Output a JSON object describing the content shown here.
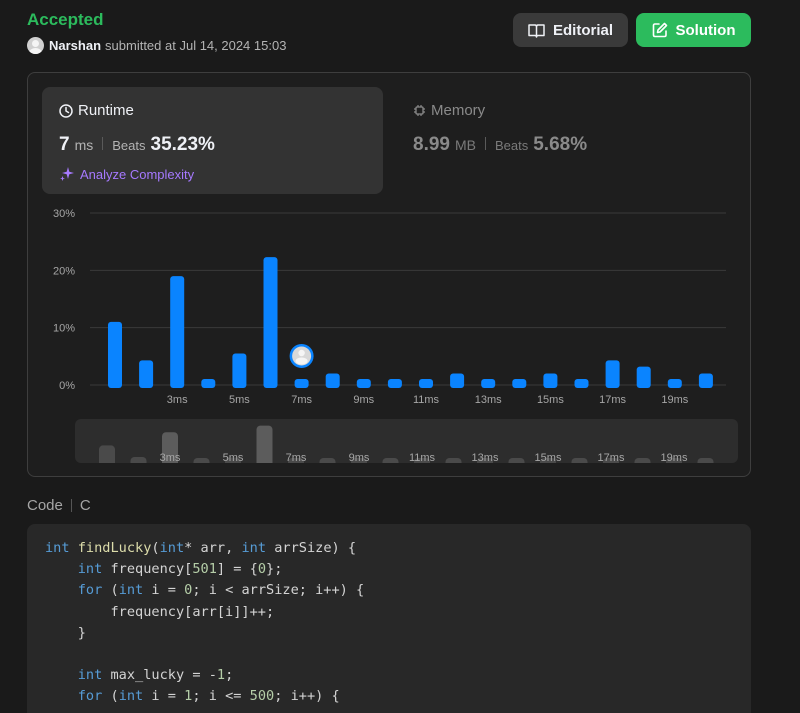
{
  "header": {
    "status": "Accepted",
    "username": "Narshan",
    "submitted_text": "submitted at Jul 14, 2024 15:03",
    "editorial_label": "Editorial",
    "solution_label": "Solution"
  },
  "runtime": {
    "title": "Runtime",
    "value": "7",
    "unit": "ms",
    "beats_label": "Beats",
    "beats_value": "35.23%",
    "analyze_label": "Analyze Complexity"
  },
  "memory": {
    "title": "Memory",
    "value": "8.99",
    "unit": "MB",
    "beats_label": "Beats",
    "beats_value": "5.68%"
  },
  "chart_data": {
    "type": "bar",
    "categories": [
      "1ms",
      "2ms",
      "3ms",
      "4ms",
      "5ms",
      "6ms",
      "7ms",
      "8ms",
      "9ms",
      "10ms",
      "11ms",
      "12ms",
      "13ms",
      "14ms",
      "15ms",
      "16ms",
      "17ms",
      "18ms",
      "19ms",
      "20ms"
    ],
    "values": [
      11,
      4.3,
      19,
      0.9,
      5.5,
      22.3,
      0.9,
      2,
      1,
      1,
      1,
      2,
      1,
      1,
      2,
      1,
      4.3,
      3.2,
      1,
      2
    ],
    "y_ticks": [
      "30%",
      "20%",
      "10%",
      "0%"
    ],
    "ylim": [
      0,
      30
    ],
    "x_tick_labels": [
      "3ms",
      "5ms",
      "7ms",
      "9ms",
      "11ms",
      "13ms",
      "15ms",
      "17ms",
      "19ms"
    ],
    "highlight_category": "7ms",
    "grid": true,
    "bar_color": "#0a84ff",
    "overview_values": [
      3.2,
      1.1,
      5.6,
      0.9,
      1.0,
      6.8,
      0.9,
      0.9,
      0.9,
      0.9,
      0.9,
      0.9,
      0.9,
      0.9,
      0.9,
      0.9,
      0.9,
      0.9,
      0.9,
      0.9
    ]
  },
  "code": {
    "label": "Code",
    "language": "C"
  }
}
